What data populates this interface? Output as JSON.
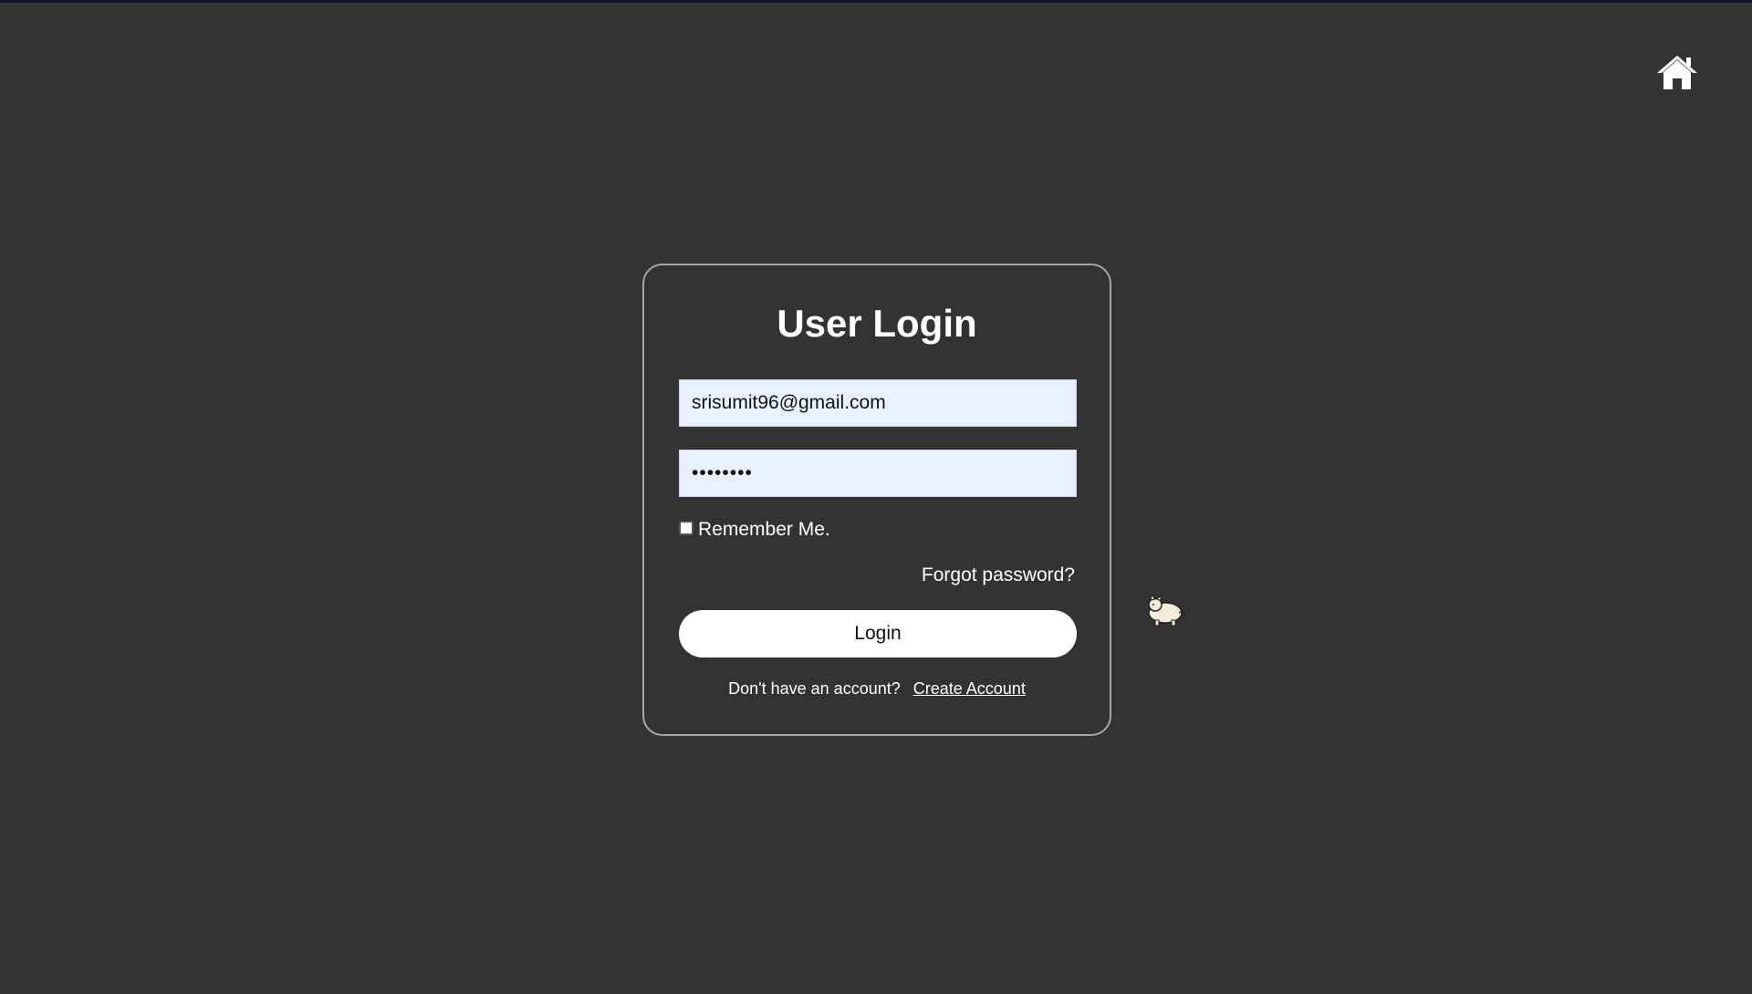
{
  "home": {
    "icon": "home-icon"
  },
  "login": {
    "title": "User Login",
    "email_value": "srisumit96@gmail.com",
    "password_value": "••••••••",
    "remember_label": "Remember Me.",
    "forgot_label": "Forgot password?",
    "login_label": "Login",
    "signup_prompt": "Don't have an account?",
    "create_account_label": "Create Account"
  },
  "decor": {
    "pet_icon": "cat-icon"
  },
  "colors": {
    "background": "#333333",
    "input_fill": "#e8f0fe",
    "card_border": "#a6a6a6",
    "text": "#ffffff"
  }
}
